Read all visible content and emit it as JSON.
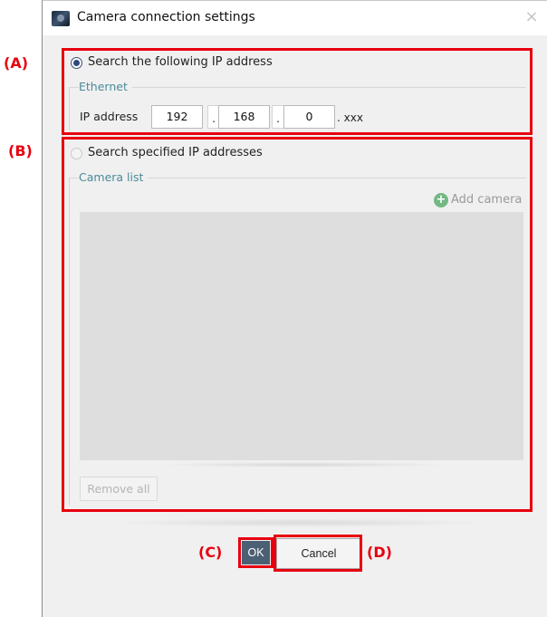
{
  "window": {
    "title": "Camera connection settings",
    "icon": "camera-app-icon",
    "close_glyph": "×"
  },
  "options": {
    "search_ip": {
      "label": "Search the following IP address",
      "selected": true
    },
    "ethernet": {
      "group_title": "Ethernet",
      "ip_label": "IP address",
      "octets": [
        "192",
        "168",
        "0"
      ],
      "separator": ".",
      "suffix": ". xxx"
    },
    "search_specified": {
      "label": "Search specified IP addresses",
      "selected": false
    },
    "camera_list": {
      "group_title": "Camera list",
      "add_label": "Add camera",
      "add_icon_glyph": "+",
      "remove_all_label": "Remove all"
    }
  },
  "buttons": {
    "ok_label": "OK",
    "cancel_label": "Cancel"
  },
  "annotations": {
    "a": "(A)",
    "b": "(B)",
    "c": "(C)",
    "d": "(D)",
    "color": "#e8000f"
  },
  "colors": {
    "dialog_bg": "#f0f0f0",
    "ok_button": "#4c6074",
    "group_title": "#4a8a9a",
    "add_icon": "#74b884",
    "list_bg": "#dedede"
  }
}
